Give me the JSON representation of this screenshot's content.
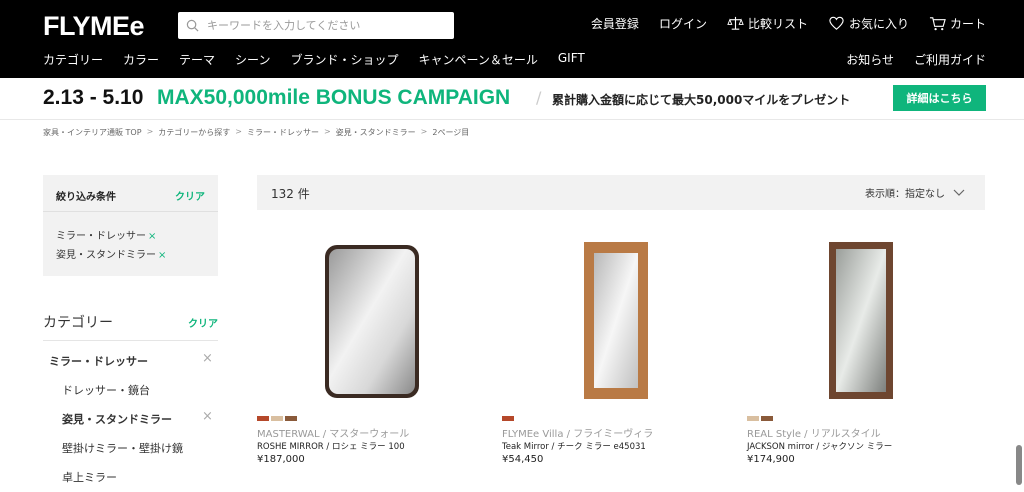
{
  "header": {
    "logo": "FLYMEe",
    "search_placeholder": "キーワードを入力してください",
    "top_links": {
      "register": "会員登録",
      "login": "ログイン",
      "compare": "比較リスト",
      "favorites": "お気に入り",
      "cart": "カート"
    },
    "nav": [
      "カテゴリー",
      "カラー",
      "テーマ",
      "シーン",
      "ブランド・ショップ",
      "キャンペーン＆セール",
      "GIFT"
    ],
    "nav_right": [
      "お知らせ",
      "ご利用ガイド"
    ]
  },
  "campaign": {
    "dates": "2.13 - 5.10",
    "title": "MAX50,000mile BONUS CAMPAIGN",
    "description": "累計購入金額に応じて最大50,000マイルをプレゼント",
    "button": "詳細はこちら",
    "accent_color": "#0fb57c"
  },
  "breadcrumb": [
    "家具・インテリア通販 TOP",
    "カテゴリーから探す",
    "ミラー・ドレッサー",
    "姿見・スタンドミラー",
    "2ページ目"
  ],
  "filters": {
    "title": "絞り込み条件",
    "clear": "クリア",
    "chips": [
      "ミラー・ドレッサー",
      "姿見・スタンドミラー"
    ]
  },
  "category": {
    "title": "カテゴリー",
    "clear": "クリア",
    "items": [
      {
        "label": "ミラー・ドレッサー",
        "level": 0,
        "bold": true,
        "removable": true
      },
      {
        "label": "ドレッサー・鏡台",
        "level": 1,
        "bold": false,
        "removable": false
      },
      {
        "label": "姿見・スタンドミラー",
        "level": 1,
        "bold": true,
        "removable": true
      },
      {
        "label": "壁掛けミラー・壁掛け鏡",
        "level": 1,
        "bold": false,
        "removable": false
      },
      {
        "label": "卓上ミラー",
        "level": 1,
        "bold": false,
        "removable": false
      }
    ]
  },
  "results": {
    "count": "132 件",
    "sort": "表示順：指定なし"
  },
  "products": [
    {
      "brand": "MASTERWAL / マスターウォール",
      "name": "ROSHE MIRROR / ロシェ ミラー 100",
      "price": "¥187,000",
      "swatches": [
        "#b5482a",
        "#d9bfa0",
        "#8a5a3a"
      ],
      "frame_icon": "rounded-dark-frame-mirror"
    },
    {
      "brand": "FLYMEe Villa / フライミーヴィラ",
      "name": "Teak Mirror / チーク ミラー e45031",
      "price": "¥54,450",
      "swatches": [
        "#b5482a"
      ],
      "frame_icon": "teak-frame-mirror"
    },
    {
      "brand": "REAL Style / リアルスタイル",
      "name": "JACKSON mirror / ジャクソン ミラー",
      "price": "¥174,900",
      "swatches": [
        "#d9bfa0",
        "#8a5a3a"
      ],
      "frame_icon": "walnut-frame-mirror"
    }
  ]
}
